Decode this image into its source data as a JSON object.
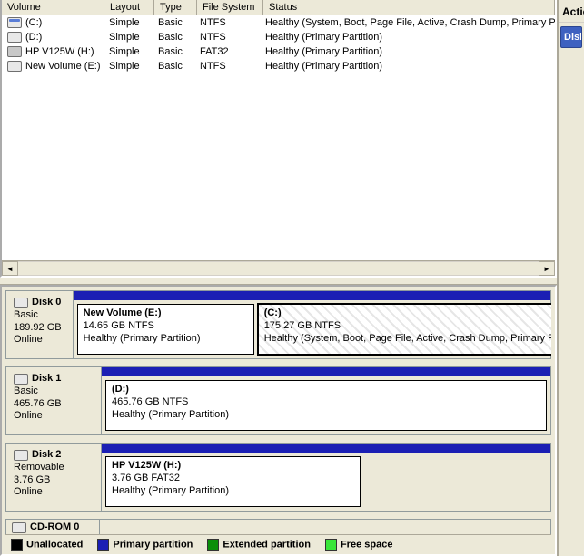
{
  "columns": {
    "volume": "Volume",
    "layout": "Layout",
    "type": "Type",
    "filesystem": "File System",
    "status": "Status"
  },
  "volumes": [
    {
      "name": "(C:)",
      "icon": "blue",
      "layout": "Simple",
      "type": "Basic",
      "fs": "NTFS",
      "status": "Healthy (System, Boot, Page File, Active, Crash Dump, Primary Partition)"
    },
    {
      "name": "(D:)",
      "icon": "plain",
      "layout": "Simple",
      "type": "Basic",
      "fs": "NTFS",
      "status": "Healthy (Primary Partition)"
    },
    {
      "name": "HP V125W (H:)",
      "icon": "rem",
      "layout": "Simple",
      "type": "Basic",
      "fs": "FAT32",
      "status": "Healthy (Primary Partition)"
    },
    {
      "name": "New Volume (E:)",
      "icon": "plain",
      "layout": "Simple",
      "type": "Basic",
      "fs": "NTFS",
      "status": "Healthy (Primary Partition)"
    }
  ],
  "disks": [
    {
      "title": "Disk 0",
      "kind": "Basic",
      "size": "189.92 GB",
      "state": "Online",
      "partitions": [
        {
          "title": "New Volume  (E:)",
          "size": "14.65 GB NTFS",
          "status": "Healthy (Primary Partition)",
          "flex": "0 0 35%",
          "active": false
        },
        {
          "title": "(C:)",
          "size": "175.27 GB NTFS",
          "status": "Healthy (System, Boot, Page File, Active, Crash Dump, Primary Partition)",
          "flex": "1",
          "active": true
        }
      ]
    },
    {
      "title": "Disk 1",
      "kind": "Basic",
      "size": "465.76 GB",
      "state": "Online",
      "partitions": [
        {
          "title": "(D:)",
          "size": "465.76 GB NTFS",
          "status": "Healthy (Primary Partition)",
          "flex": "1",
          "active": false
        }
      ]
    },
    {
      "title": "Disk 2",
      "kind": "Removable",
      "size": "3.76 GB",
      "state": "Online",
      "partitions": [
        {
          "title": "HP V125W  (H:)",
          "size": "3.76 GB FAT32",
          "status": "Healthy (Primary Partition)",
          "flex": "0 0 55%",
          "active": false
        }
      ]
    }
  ],
  "cdrom": {
    "title": "CD-ROM 0"
  },
  "legend": {
    "unalloc": "Unallocated",
    "primary": "Primary partition",
    "extended": "Extended partition",
    "free": "Free space"
  },
  "actions": {
    "header": "Actions",
    "item": "Disk Management"
  }
}
